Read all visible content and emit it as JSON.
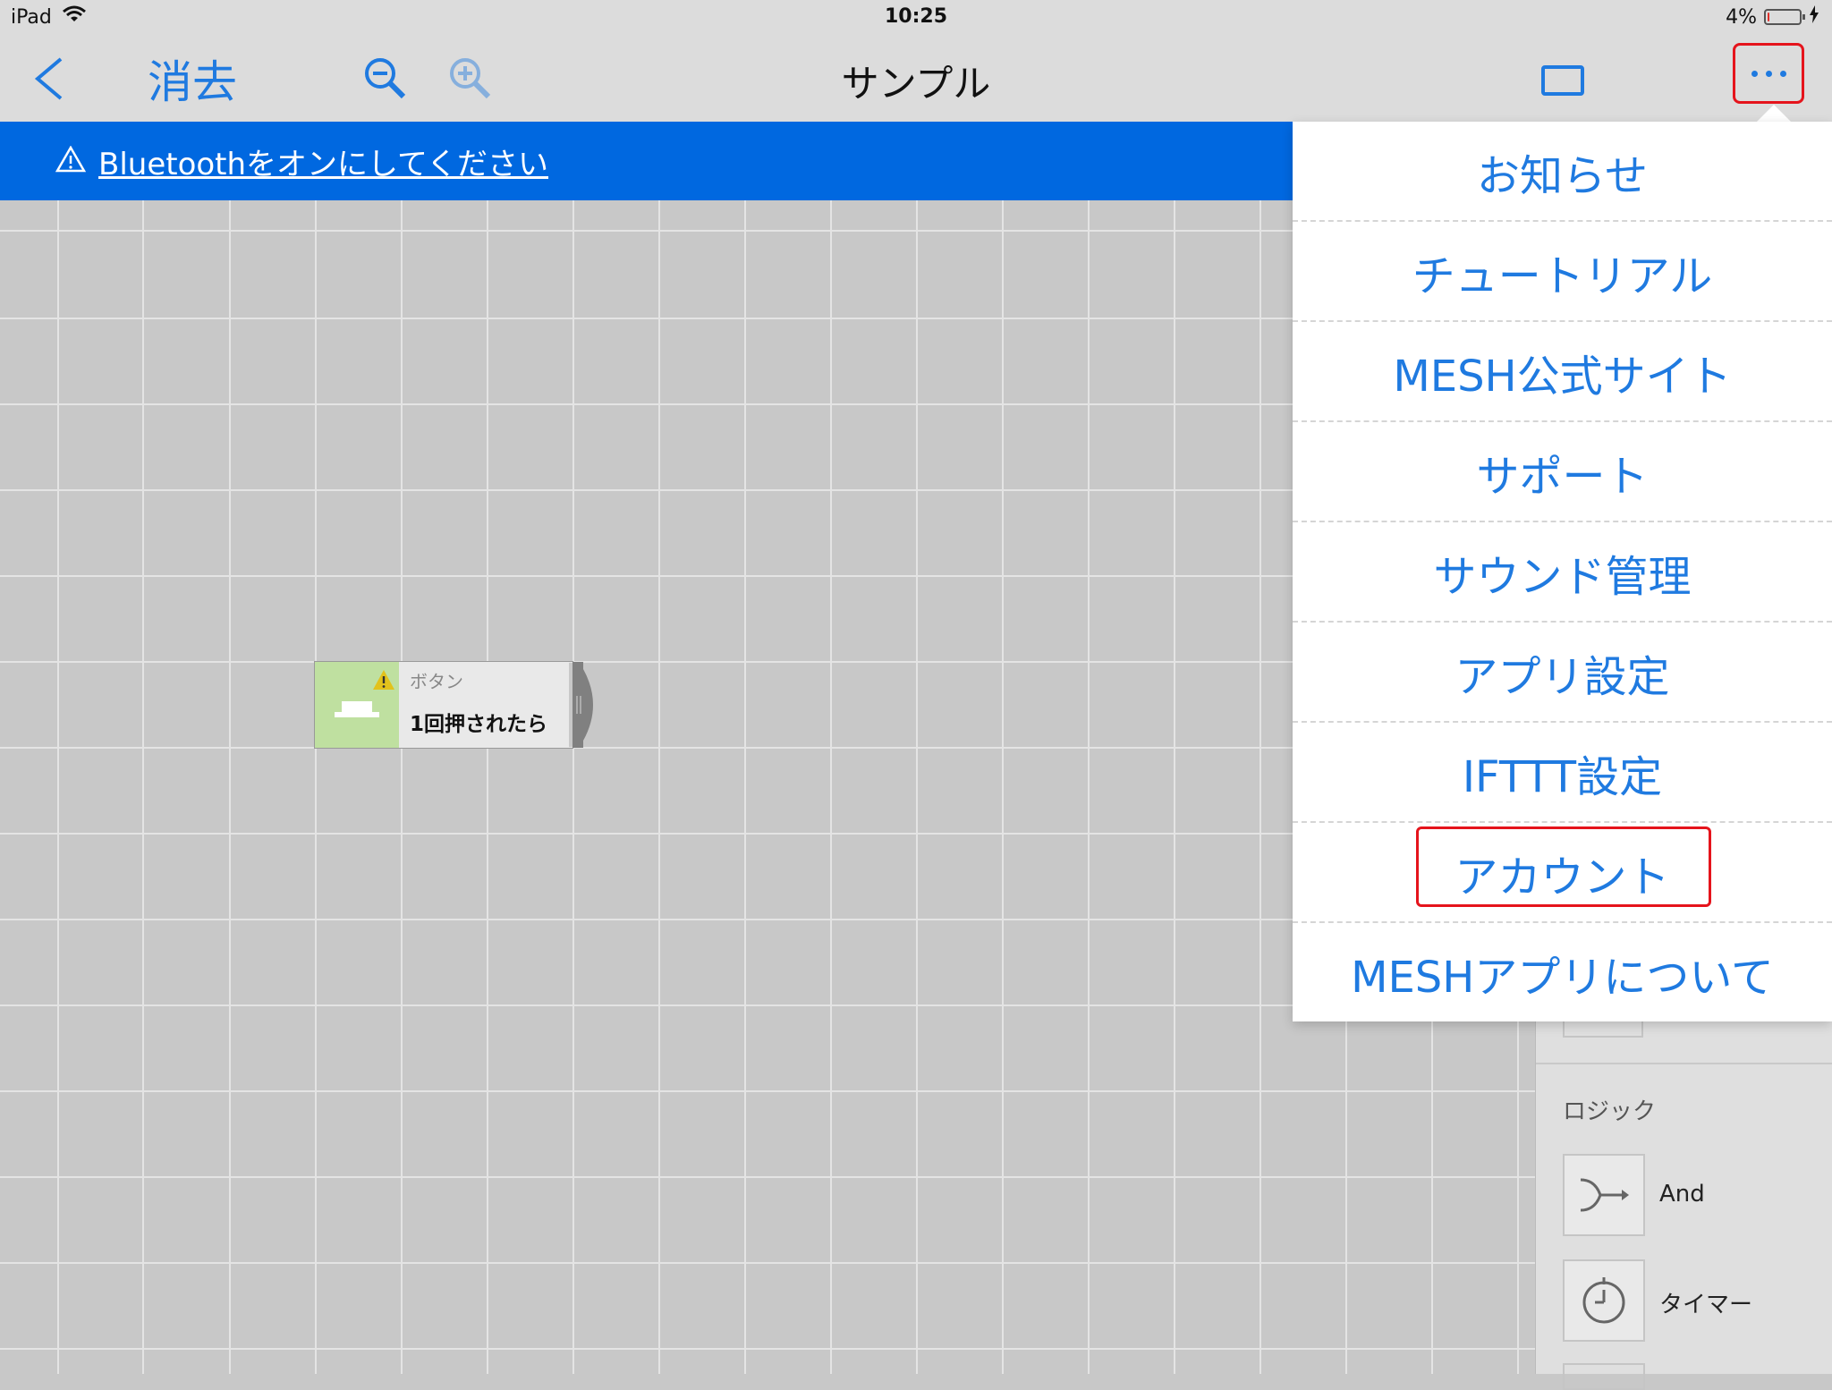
{
  "status_bar": {
    "device": "iPad",
    "time": "10:25",
    "battery_percent": "4%",
    "battery_level": 0.04
  },
  "nav": {
    "back_icon": "chevron-left-icon",
    "clear_label": "消去",
    "zoom_out_icon": "zoom-out-icon",
    "zoom_in_icon": "zoom-in-icon",
    "title": "サンプル",
    "layout_icon": "rectangle-icon",
    "more_icon": "more-dots-icon"
  },
  "banner": {
    "icon": "warning-icon",
    "text": "Bluetoothをオンにしてください"
  },
  "canvas_node": {
    "type_label": "ボタン",
    "action_label": "1回押されたら",
    "icon": "button-block-icon",
    "warning_icon": "warning-icon"
  },
  "sidebar": {
    "logic_heading": "ロジック",
    "items": [
      {
        "label": "And",
        "icon": "and-logic-icon"
      },
      {
        "label": "タイマー",
        "icon": "timer-icon"
      }
    ]
  },
  "menu": {
    "items": [
      {
        "label": "お知らせ"
      },
      {
        "label": "チュートリアル"
      },
      {
        "label": "MESH公式サイト"
      },
      {
        "label": "サポート"
      },
      {
        "label": "サウンド管理"
      },
      {
        "label": "アプリ設定"
      },
      {
        "label": "IFTTT設定"
      },
      {
        "label": "アカウント"
      },
      {
        "label": "MESHアプリについて"
      }
    ],
    "highlighted_index": 7
  },
  "colors": {
    "accent": "#1f7ae0",
    "banner": "#0068e0",
    "highlight": "#e5141c",
    "canvas": "#c8c8c8"
  }
}
